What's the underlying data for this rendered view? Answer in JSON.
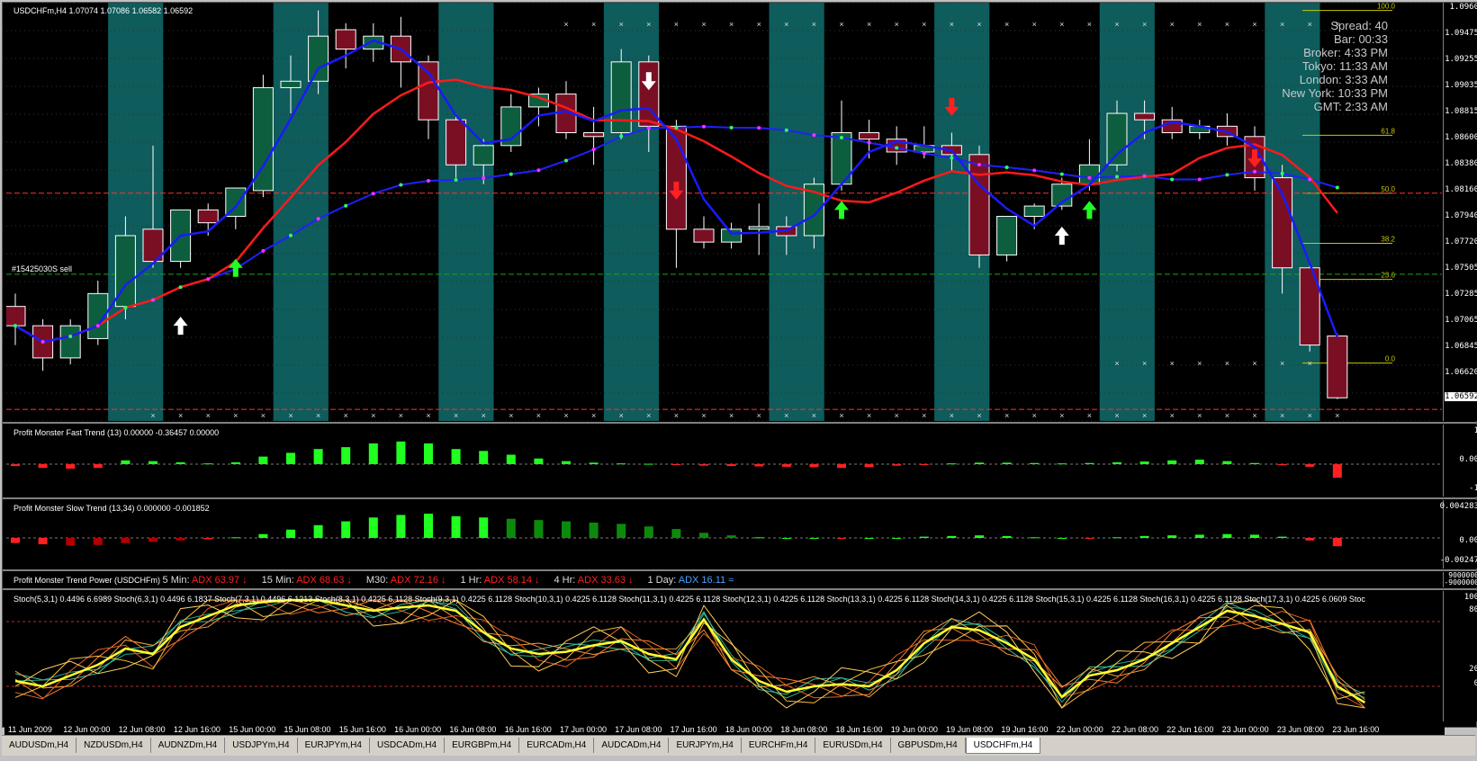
{
  "chart": {
    "symbol_header": "USDCHFm,H4  1.07074 1.07086 1.06582 1.06592",
    "order_label": "#15425030S sell"
  },
  "info_box": {
    "lines": [
      {
        "label": "Spread:",
        "value": "40"
      },
      {
        "label": "Bar:",
        "value": "00:33"
      },
      {
        "label": "Broker:",
        "value": "4:33 PM"
      },
      {
        "label": "Tokyo:",
        "value": "11:33 AM"
      },
      {
        "label": "London:",
        "value": "3:33 AM"
      },
      {
        "label": "New York:",
        "value": "10:33 PM"
      },
      {
        "label": "GMT:",
        "value": "2:33 AM"
      }
    ]
  },
  "price_axis": [
    "1.0960",
    "1.09475",
    "1.09255",
    "1.09035",
    "1.08815",
    "1.08600",
    "1.08380",
    "1.08160",
    "1.07940",
    "1.07720",
    "1.07505",
    "1.07285",
    "1.07065",
    "1.06845",
    "1.06620",
    "1.06410"
  ],
  "current_price": "1.06592",
  "fib_levels": [
    {
      "label": "100.0",
      "price": 1.096
    },
    {
      "label": "61.8",
      "price": 1.0863
    },
    {
      "label": "50.0",
      "price": 1.0818
    },
    {
      "label": "38.2",
      "price": 1.0779
    },
    {
      "label": "23.6",
      "price": 1.0751
    },
    {
      "label": "0.0",
      "price": 1.0686
    }
  ],
  "candles": [
    {
      "o": 1.073,
      "h": 1.074,
      "c": 1.0715,
      "l": 1.07
    },
    {
      "o": 1.0715,
      "h": 1.072,
      "c": 1.069,
      "l": 1.068
    },
    {
      "o": 1.069,
      "h": 1.072,
      "c": 1.0715,
      "l": 1.0685
    },
    {
      "o": 1.0705,
      "h": 1.075,
      "c": 1.074,
      "l": 1.07
    },
    {
      "o": 1.073,
      "h": 1.08,
      "c": 1.0785,
      "l": 1.072
    },
    {
      "o": 1.079,
      "h": 1.0855,
      "c": 1.0765,
      "l": 1.076
    },
    {
      "o": 1.0765,
      "h": 1.0805,
      "c": 1.0805,
      "l": 1.076
    },
    {
      "o": 1.0805,
      "h": 1.081,
      "c": 1.0795,
      "l": 1.0785
    },
    {
      "o": 1.08,
      "h": 1.082,
      "c": 1.0822,
      "l": 1.079
    },
    {
      "o": 1.082,
      "h": 1.091,
      "c": 1.09,
      "l": 1.0815
    },
    {
      "o": 1.09,
      "h": 1.0925,
      "c": 1.0905,
      "l": 1.088
    },
    {
      "o": 1.0905,
      "h": 1.096,
      "c": 1.094,
      "l": 1.0895
    },
    {
      "o": 1.0945,
      "h": 1.095,
      "c": 1.093,
      "l": 1.0915
    },
    {
      "o": 1.093,
      "h": 1.095,
      "c": 1.094,
      "l": 1.092
    },
    {
      "o": 1.094,
      "h": 1.0955,
      "c": 1.092,
      "l": 1.09
    },
    {
      "o": 1.092,
      "h": 1.0925,
      "c": 1.0875,
      "l": 1.086
    },
    {
      "o": 1.0875,
      "h": 1.088,
      "c": 1.084,
      "l": 1.083
    },
    {
      "o": 1.084,
      "h": 1.086,
      "c": 1.0855,
      "l": 1.0825
    },
    {
      "o": 1.0855,
      "h": 1.0895,
      "c": 1.0885,
      "l": 1.085
    },
    {
      "o": 1.0885,
      "h": 1.09,
      "c": 1.0895,
      "l": 1.087
    },
    {
      "o": 1.0895,
      "h": 1.0905,
      "c": 1.0865,
      "l": 1.086
    },
    {
      "o": 1.0865,
      "h": 1.0885,
      "c": 1.0862,
      "l": 1.084
    },
    {
      "o": 1.0865,
      "h": 1.093,
      "c": 1.092,
      "l": 1.086
    },
    {
      "o": 1.092,
      "h": 1.0925,
      "c": 1.087,
      "l": 1.085
    },
    {
      "o": 1.087,
      "h": 1.0875,
      "c": 1.079,
      "l": 1.076
    },
    {
      "o": 1.079,
      "h": 1.08,
      "c": 1.078,
      "l": 1.0775
    },
    {
      "o": 1.078,
      "h": 1.0795,
      "c": 1.079,
      "l": 1.0775
    },
    {
      "o": 1.079,
      "h": 1.081,
      "c": 1.0792,
      "l": 1.077
    },
    {
      "o": 1.0792,
      "h": 1.08,
      "c": 1.0785,
      "l": 1.077
    },
    {
      "o": 1.0785,
      "h": 1.083,
      "c": 1.0825,
      "l": 1.0775
    },
    {
      "o": 1.0825,
      "h": 1.089,
      "c": 1.0865,
      "l": 1.082
    },
    {
      "o": 1.0865,
      "h": 1.0875,
      "c": 1.086,
      "l": 1.0845
    },
    {
      "o": 1.086,
      "h": 1.087,
      "c": 1.085,
      "l": 1.084
    },
    {
      "o": 1.085,
      "h": 1.087,
      "c": 1.0855,
      "l": 1.0845
    },
    {
      "o": 1.0855,
      "h": 1.0865,
      "c": 1.0848,
      "l": 1.0835
    },
    {
      "o": 1.0848,
      "h": 1.0855,
      "c": 1.077,
      "l": 1.076
    },
    {
      "o": 1.077,
      "h": 1.08,
      "c": 1.08,
      "l": 1.0765
    },
    {
      "o": 1.08,
      "h": 1.081,
      "c": 1.0808,
      "l": 1.079
    },
    {
      "o": 1.0808,
      "h": 1.083,
      "c": 1.0825,
      "l": 1.0805
    },
    {
      "o": 1.0825,
      "h": 1.086,
      "c": 1.084,
      "l": 1.082
    },
    {
      "o": 1.084,
      "h": 1.089,
      "c": 1.088,
      "l": 1.0835
    },
    {
      "o": 1.088,
      "h": 1.089,
      "c": 1.0875,
      "l": 1.086
    },
    {
      "o": 1.0875,
      "h": 1.0885,
      "c": 1.0865,
      "l": 1.086
    },
    {
      "o": 1.0865,
      "h": 1.0875,
      "c": 1.087,
      "l": 1.086
    },
    {
      "o": 1.087,
      "h": 1.088,
      "c": 1.0862,
      "l": 1.0855
    },
    {
      "o": 1.0862,
      "h": 1.087,
      "c": 1.083,
      "l": 1.082
    },
    {
      "o": 1.083,
      "h": 1.084,
      "c": 1.076,
      "l": 1.074
    },
    {
      "o": 1.076,
      "h": 1.0765,
      "c": 1.07,
      "l": 1.0695
    },
    {
      "o": 1.0707,
      "h": 1.0709,
      "c": 1.0659,
      "l": 1.0658
    }
  ],
  "fast_trend": {
    "title": "Profit Monster Fast Trend (13) 0.00000 -0.36457 0.00000",
    "levels": [
      "1",
      "0.00",
      "-1"
    ],
    "values": [
      -0.05,
      -0.1,
      -0.12,
      -0.1,
      0.1,
      0.08,
      0.05,
      0.02,
      0.05,
      0.2,
      0.3,
      0.4,
      0.45,
      0.55,
      0.6,
      0.55,
      0.4,
      0.35,
      0.25,
      0.15,
      0.08,
      0.04,
      0.02,
      0.01,
      -0.02,
      -0.04,
      -0.05,
      -0.06,
      -0.07,
      -0.08,
      -0.1,
      -0.08,
      -0.04,
      -0.02,
      0.02,
      0.04,
      0.04,
      0.03,
      0.02,
      0.03,
      0.05,
      0.07,
      0.1,
      0.12,
      0.08,
      0.03,
      -0.03,
      -0.07,
      -0.36
    ]
  },
  "slow_trend": {
    "title": "Profit Monster Slow Trend (13,34) 0.000000 -0.001852",
    "levels": [
      "0.004283",
      "0.00",
      "-0.00247"
    ],
    "values": [
      -0.0008,
      -0.001,
      -0.0012,
      -0.0011,
      -0.0008,
      -0.0006,
      -0.0004,
      -0.0002,
      0.0001,
      0.0006,
      0.0013,
      0.002,
      0.0026,
      0.0032,
      0.0036,
      0.0038,
      0.0034,
      0.0032,
      0.003,
      0.0028,
      0.0026,
      0.0024,
      0.0022,
      0.0018,
      0.0014,
      0.0008,
      0.0004,
      0.0001,
      0.0,
      0.0,
      -0.0001,
      0.0,
      0.0,
      0.0002,
      0.0003,
      0.0004,
      0.0003,
      0.0001,
      0.0,
      -0.0001,
      0.0001,
      0.0003,
      0.0004,
      0.0005,
      0.0006,
      0.0005,
      0.0002,
      -0.0004,
      -0.0013
    ]
  },
  "trend_power": {
    "title": "Profit Monster Trend Power (USDCHFm)",
    "items": [
      {
        "tf": "5 Min:",
        "val": "ADX 63.97",
        "arrow": "↓",
        "color": "#ff2020"
      },
      {
        "tf": "15 Min:",
        "val": "ADX 68.63",
        "arrow": "↓",
        "color": "#ff2020"
      },
      {
        "tf": "M30:",
        "val": "ADX 72.16",
        "arrow": "↓",
        "color": "#ff2020"
      },
      {
        "tf": "1 Hr:",
        "val": "ADX 58.14",
        "arrow": "↓",
        "color": "#ff2020"
      },
      {
        "tf": "4 Hr:",
        "val": "ADX 33.63",
        "arrow": "↓",
        "color": "#ff2020"
      },
      {
        "tf": "1 Day:",
        "val": "ADX 16.11",
        "arrow": "≈",
        "color": "#4aa0ff"
      }
    ],
    "axis": [
      "9000000",
      "-9000000"
    ]
  },
  "stoch": {
    "title": "Stoch(5,3,1) 0.4496 6.6989  Stoch(6,3,1) 0.4496 6.1837  Stoch(7,3,1) 0.4496 6.1213  Stoch(8,3,1) 0.4225 6.1128  Stoch(9,3,1) 0.4225 6.1128  Stoch(10,3,1) 0.4225 6.1128  Stoch(11,3,1) 0.4225 6.1128  Stoch(12,3,1) 0.4225 6.1128  Stoch(13,3,1) 0.4225 6.1128  Stoch(14,3,1) 0.4225 6.1128  Stoch(15,3,1) 0.4225 6.1128  Stoch(16,3,1) 0.4225 6.1128  Stoch(17,3,1) 0.4225 6.0609  Stoc",
    "levels": [
      "100",
      "80",
      "20",
      "0"
    ],
    "main": [
      25,
      20,
      30,
      40,
      55,
      50,
      75,
      85,
      95,
      98,
      100,
      100,
      95,
      90,
      93,
      95,
      90,
      70,
      55,
      50,
      52,
      58,
      62,
      50,
      45,
      82,
      45,
      25,
      15,
      20,
      22,
      20,
      35,
      60,
      75,
      72,
      60,
      45,
      10,
      30,
      35,
      45,
      60,
      75,
      90,
      85,
      78,
      70,
      20,
      5
    ]
  },
  "time_axis": [
    "11 Jun 2009",
    "12 Jun 00:00",
    "12 Jun 08:00",
    "12 Jun 16:00",
    "15 Jun 00:00",
    "15 Jun 08:00",
    "15 Jun 16:00",
    "16 Jun 00:00",
    "16 Jun 08:00",
    "16 Jun 16:00",
    "17 Jun 00:00",
    "17 Jun 08:00",
    "17 Jun 16:00",
    "18 Jun 00:00",
    "18 Jun 08:00",
    "18 Jun 16:00",
    "19 Jun 00:00",
    "19 Jun 08:00",
    "19 Jun 16:00",
    "22 Jun 00:00",
    "22 Jun 08:00",
    "22 Jun 16:00",
    "23 Jun 00:00",
    "23 Jun 08:00",
    "23 Jun 16:00"
  ],
  "tabs": [
    "AUDUSDm,H4",
    "NZDUSDm,H4",
    "AUDNZDm,H4",
    "USDJPYm,H4",
    "EURJPYm,H4",
    "USDCADm,H4",
    "EURGBPm,H4",
    "EURCADm,H4",
    "AUDCADm,H4",
    "EURJPYm,H4",
    "EURCHFm,H4",
    "EURUSDm,H4",
    "GBPUSDm,H4",
    "USDCHFm,H4"
  ],
  "active_tab": "USDCHFm,H4",
  "colors": {
    "bull": "#0d5e3f",
    "bear": "#7a0f24",
    "band": "#0e5c5c",
    "ma_red": "#ff1a1a",
    "ma_blue": "#1a1aff",
    "stoch_yellow": "#ffff30"
  }
}
